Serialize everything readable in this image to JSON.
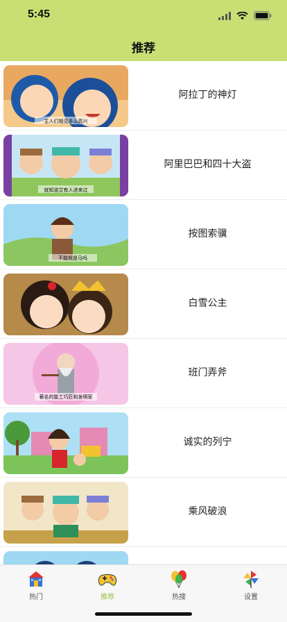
{
  "status": {
    "time": "5:45"
  },
  "header": {
    "title": "推荐"
  },
  "stories": [
    {
      "title": "阿拉丁的神灯",
      "caption": "主人们相见多么高兴"
    },
    {
      "title": "阿里巴巴和四十大盗",
      "caption": "就知道艾有人进来过"
    },
    {
      "title": "按图索骥",
      "caption": "不能就是马吗"
    },
    {
      "title": "白雪公主",
      "caption": ""
    },
    {
      "title": "班门弄斧",
      "caption": "著名的能工巧匠和发明家"
    },
    {
      "title": "诚实的列宁",
      "caption": ""
    },
    {
      "title": "乘风破浪",
      "caption": ""
    },
    {
      "title": "",
      "caption": ""
    }
  ],
  "tabs": [
    {
      "label": "热门",
      "icon": "house-icon"
    },
    {
      "label": "推荐",
      "icon": "gamepad-icon"
    },
    {
      "label": "热搜",
      "icon": "balloons-icon"
    },
    {
      "label": "设置",
      "icon": "pinwheel-icon"
    }
  ],
  "colors": {
    "header": "#c9df74",
    "active_tab": "#9bc34a"
  }
}
